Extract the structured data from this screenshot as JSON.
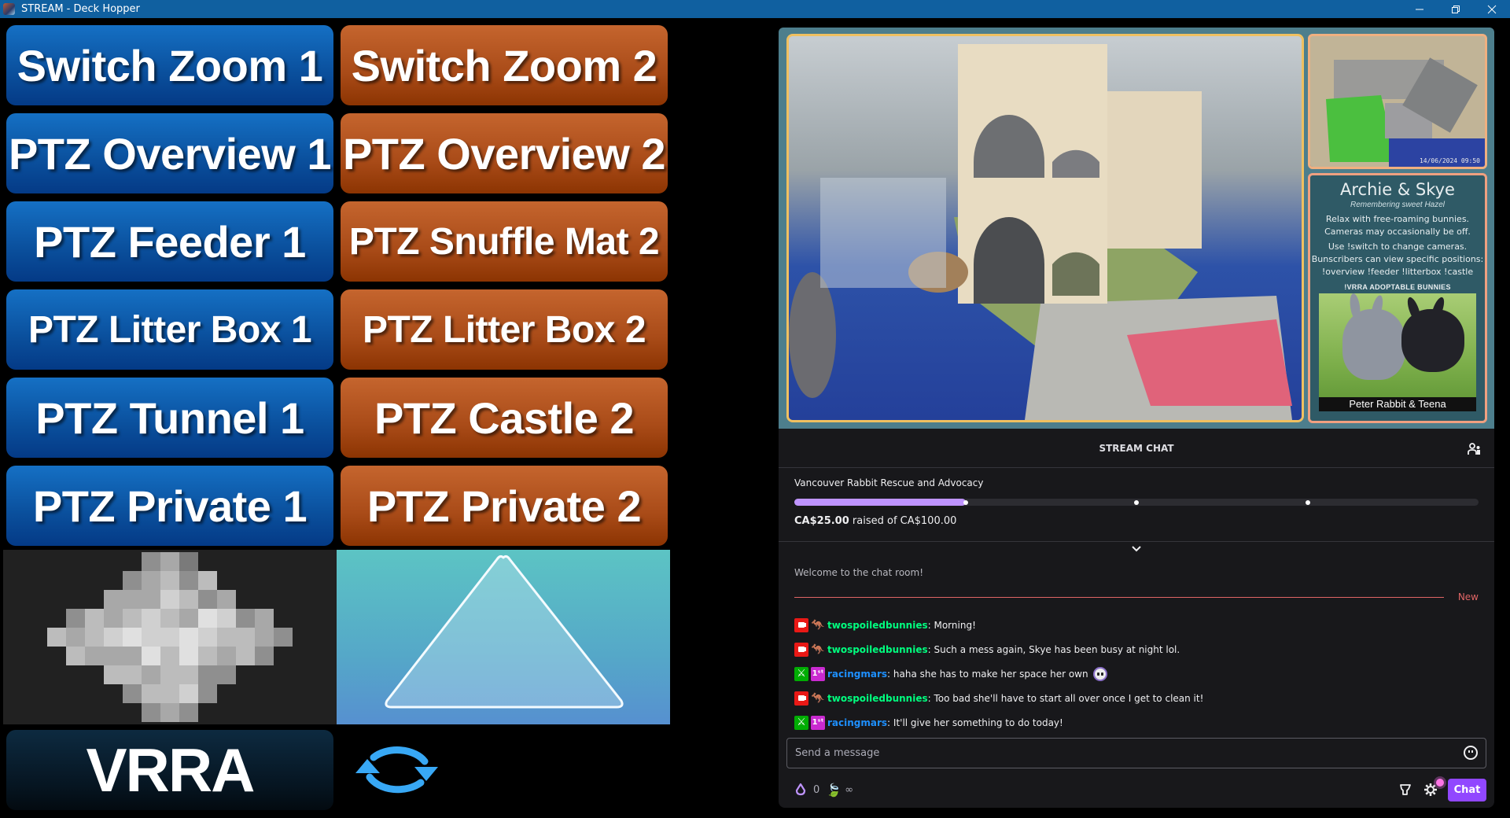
{
  "window": {
    "title": "STREAM - Deck Hopper",
    "controls": {
      "minimize": "—",
      "restore": "❐",
      "close": "✕"
    }
  },
  "deck": {
    "buttons": [
      {
        "label": "Switch Zoom 1",
        "color": "blue"
      },
      {
        "label": "Switch Zoom 2",
        "color": "orange"
      },
      {
        "label": "PTZ Overview 1",
        "color": "blue"
      },
      {
        "label": "PTZ Overview 2",
        "color": "orange"
      },
      {
        "label": "PTZ Feeder 1",
        "color": "blue"
      },
      {
        "label": "PTZ Snuffle Mat 2",
        "color": "orange"
      },
      {
        "label": "PTZ Litter Box 1",
        "color": "blue"
      },
      {
        "label": "PTZ Litter Box 2",
        "color": "orange"
      },
      {
        "label": "PTZ Tunnel 1",
        "color": "blue"
      },
      {
        "label": "PTZ Castle 2",
        "color": "orange"
      },
      {
        "label": "PTZ Private 1",
        "color": "blue"
      },
      {
        "label": "PTZ Private 2",
        "color": "orange"
      }
    ],
    "tiles": {
      "pixelate": "pixelate-diamond-icon",
      "triangle": "triangle-icon"
    },
    "vrra_label": "VRRA",
    "refresh": "refresh-icon",
    "colors": {
      "blue": "#0a4f9c",
      "orange": "#a94b18"
    }
  },
  "stream": {
    "overlay": {
      "title": "Archie & Skye",
      "subtitle": "Remembering sweet Hazel",
      "lines": [
        "Relax with free-roaming bunnies.",
        "Cameras may occasionally be off.",
        "Use !switch to change cameras.",
        "Bunscribers can view specific positions:",
        "!overview !feeder !litterbox !castle"
      ],
      "adoptable_heading": "!VRRA ADOPTABLE BUNNIES",
      "adoptable_caption": "Peter Rabbit & Teena"
    },
    "side_cam_timestamp": "14/06/2024 09:50"
  },
  "chat": {
    "header": "STREAM CHAT",
    "goal": {
      "name": "Vancouver Rabbit Rescue and Advocacy",
      "raised": "CA$25.00",
      "raised_text": "raised of CA$100.00",
      "progress": 0.25,
      "milestones": [
        0.25,
        0.5,
        0.75
      ]
    },
    "welcome": "Welcome to the chat room!",
    "new_label": "New",
    "messages": [
      {
        "badges": [
          "broadcaster",
          "sub"
        ],
        "user": "twospoiledbunnies",
        "color": "#00ff7f",
        "text": ": Morning!"
      },
      {
        "badges": [
          "broadcaster",
          "sub"
        ],
        "user": "twospoiledbunnies",
        "color": "#00ff7f",
        "text": ": Such a mess again, Skye has been busy at night lol."
      },
      {
        "badges": [
          "moderator",
          "first"
        ],
        "user": "racingmars",
        "color": "#1e90ff",
        "text": ": haha she has to make her space her own",
        "emote": true
      },
      {
        "badges": [
          "broadcaster",
          "sub"
        ],
        "user": "twospoiledbunnies",
        "color": "#00ff7f",
        "text": ": Too bad she'll have to start all over once I get to clean it!"
      },
      {
        "badges": [
          "moderator",
          "first"
        ],
        "user": "racingmars",
        "color": "#1e90ff",
        "text": ": It'll give her something to do today!"
      }
    ],
    "input_placeholder": "Send a message",
    "points": "0",
    "extra": "∞",
    "chat_button": "Chat",
    "accent": "#9147ff"
  }
}
